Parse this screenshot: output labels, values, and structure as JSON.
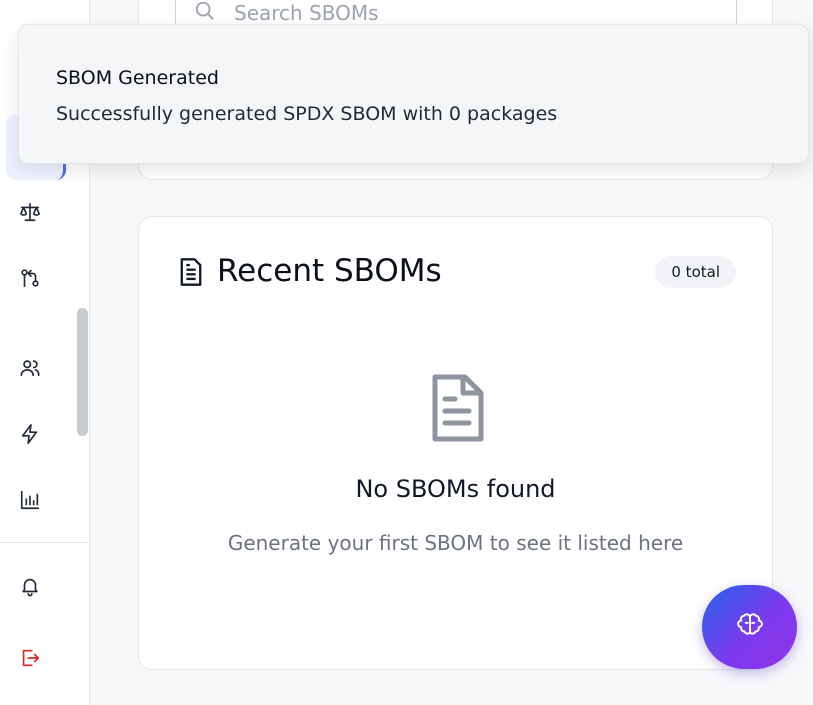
{
  "search": {
    "placeholder": "Search SBOMs"
  },
  "toast": {
    "title": "SBOM Generated",
    "message": "Successfully generated SPDX SBOM with 0 packages"
  },
  "recent": {
    "title": "Recent SBOMs",
    "total_badge": "0 total",
    "empty_title": "No SBOMs found",
    "empty_subtitle": "Generate your first SBOM to see it listed here"
  },
  "sidebar": {
    "icons": [
      "scale-icon",
      "git-compare-icon",
      "users-icon",
      "zap-icon",
      "bar-chart-icon",
      "bell-icon",
      "logout-icon"
    ]
  },
  "fab": {
    "icon": "brain-icon"
  },
  "colors": {
    "accent": "#4f6ee8",
    "logout": "#dc2626",
    "fab_gradient_start": "#2563eb",
    "fab_gradient_end": "#9333ea"
  }
}
